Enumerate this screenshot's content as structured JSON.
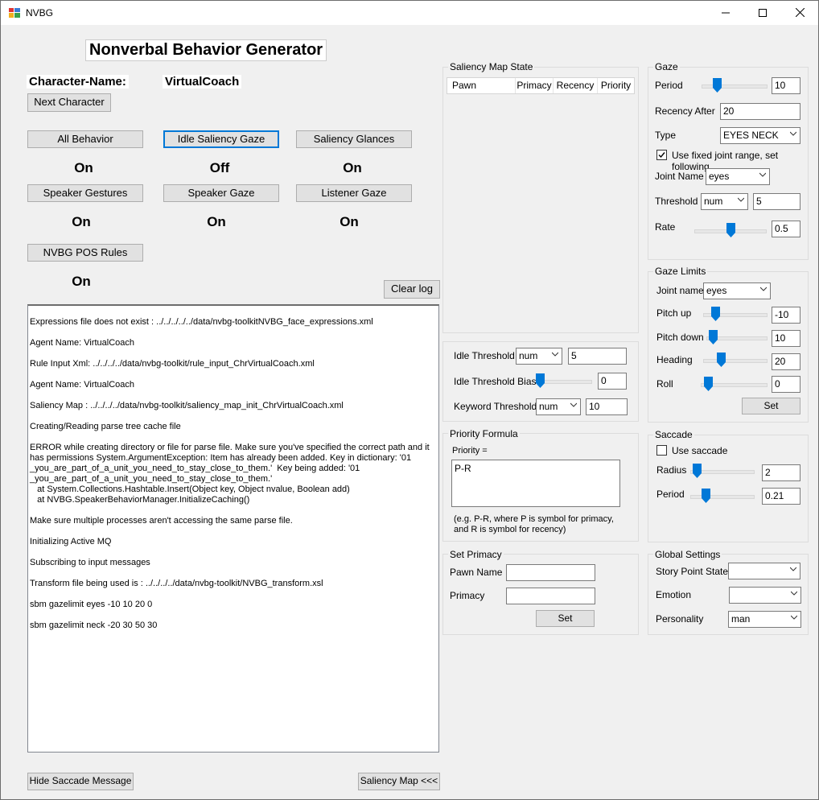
{
  "window": {
    "title": "NVBG",
    "minimize": "—",
    "maximize": "☐",
    "close": "✕"
  },
  "header": {
    "title": "Nonverbal Behavior Generator",
    "character_label": "Character-Name:",
    "character_value": "VirtualCoach",
    "next_character": "Next Character"
  },
  "behaviors": [
    {
      "label": "All Behavior",
      "state": "On"
    },
    {
      "label": "Idle Saliency Gaze",
      "state": "Off"
    },
    {
      "label": "Saliency Glances",
      "state": "On"
    },
    {
      "label": "Speaker Gestures",
      "state": "On"
    },
    {
      "label": "Speaker Gaze",
      "state": "On"
    },
    {
      "label": "Listener Gaze",
      "state": "On"
    },
    {
      "label": "NVBG POS Rules",
      "state": "On"
    }
  ],
  "clear_log": "Clear log",
  "log_lines": [
    "Expressions file does not exist : ../../../../../data/nvbg-toolkitNVBG_face_expressions.xml",
    "Agent Name: VirtualCoach",
    "Rule Input Xml: ../../../../data/nvbg-toolkit/rule_input_ChrVirtualCoach.xml",
    "Agent Name: VirtualCoach",
    "Saliency Map : ../../../../data/nvbg-toolkit/saliency_map_init_ChrVirtualCoach.xml",
    "Creating/Reading parse tree cache file",
    "ERROR while creating directory or file for parse file. Make sure you've specified the correct path and it has permissions System.ArgumentException: Item has already been added. Key in dictionary: '01\n_you_are_part_of_a_unit_you_need_to_stay_close_to_them.'  Key being added: '01\n_you_are_part_of_a_unit_you_need_to_stay_close_to_them.'\n   at System.Collections.Hashtable.Insert(Object key, Object nvalue, Boolean add)\n   at NVBG.SpeakerBehaviorManager.InitializeCaching()",
    "Make sure multiple processes aren't accessing the same parse file.",
    "Initializing Active MQ",
    "Subscribing to input messages",
    "Transform file being used is : ../../../../data/nvbg-toolkit/NVBG_transform.xsl",
    "sbm gazelimit eyes -10 10 20 0",
    "sbm gazelimit neck -20 30 50 30"
  ],
  "footer": {
    "hide_saccade": "Hide Saccade Message",
    "saliency_map": "Saliency Map <<<"
  },
  "saliency_map_state": {
    "title": "Saliency Map State",
    "columns": [
      "Pawn",
      "Primacy",
      "Recency",
      "Priority"
    ]
  },
  "idle": {
    "threshold_label": "Idle Threshold",
    "threshold_type": "num",
    "threshold_value": "5",
    "bias_label": "Idle Threshold Bias",
    "bias_value": "0",
    "bias_level": 0.0,
    "keyword_label": "Keyword Threshold",
    "keyword_type": "num",
    "keyword_value": "10"
  },
  "priority_formula": {
    "title": "Priority Formula",
    "label": "Priority =",
    "value": "P-R",
    "hint_1": "(e.g. P-R, where P is symbol for primacy,",
    "hint_2": "and R is symbol for recency)"
  },
  "set_primacy": {
    "title": "Set Primacy",
    "pawn_label": "Pawn Name",
    "primacy_label": "Primacy",
    "set_button": "Set"
  },
  "gaze": {
    "title": "Gaze",
    "period_label": "Period",
    "period_value": "10",
    "period_level": 0.2,
    "recency_label": "Recency After",
    "recency_value": "20",
    "type_label": "Type",
    "type_value": "EYES NECK",
    "fixed_joint_label": "Use fixed joint range, set following",
    "fixed_joint_checked": true,
    "joint_label": "Joint Name",
    "joint_value": "eyes",
    "threshold_label": "Threshold",
    "threshold_type": "num",
    "threshold_value": "5",
    "rate_label": "Rate",
    "rate_value": "0.5",
    "rate_level": 0.5
  },
  "gaze_limits": {
    "title": "Gaze Limits",
    "joint_label": "Joint name",
    "joint_value": "eyes",
    "pitch_up_label": "Pitch up",
    "pitch_up_value": "-10",
    "pitch_up_level": 0.15,
    "pitch_down_label": "Pitch down",
    "pitch_down_value": "10",
    "pitch_down_level": 0.05,
    "heading_label": "Heading",
    "heading_value": "20",
    "heading_level": 0.25,
    "roll_label": "Roll",
    "roll_value": "0",
    "roll_level": 0.05,
    "set_button": "Set"
  },
  "saccade": {
    "title": "Saccade",
    "use_label": "Use saccade",
    "use_checked": false,
    "radius_label": "Radius",
    "radius_value": "2",
    "radius_level": 0.05,
    "period_label": "Period",
    "period_value": "0.21",
    "period_level": 0.21
  },
  "global_settings": {
    "title": "Global Settings",
    "story_label": "Story Point State",
    "story_value": "",
    "emotion_label": "Emotion",
    "emotion_value": "",
    "personality_label": "Personality",
    "personality_value": "man"
  },
  "colors": {
    "accent": "#0078d7",
    "window_bg": "#f0f0f0"
  }
}
